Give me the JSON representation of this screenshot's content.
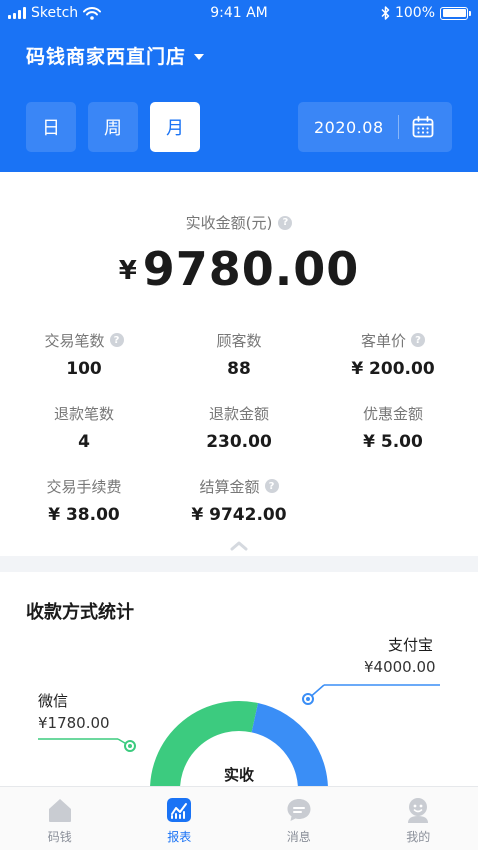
{
  "status_bar": {
    "carrier": "Sketch",
    "time": "9:41 AM",
    "battery": "100%"
  },
  "header": {
    "store_name": "码钱商家西直门店",
    "periods": [
      {
        "label": "日",
        "active": false
      },
      {
        "label": "周",
        "active": false
      },
      {
        "label": "月",
        "active": true
      }
    ],
    "date": "2020.08"
  },
  "summary": {
    "amount_label": "实收金额(元)",
    "currency": "¥",
    "amount": "9780.00",
    "stats": [
      {
        "label": "交易笔数",
        "value": "100",
        "help": true
      },
      {
        "label": "顾客数",
        "value": "88",
        "help": false
      },
      {
        "label": "客单价",
        "value": "¥ 200.00",
        "help": true
      },
      {
        "label": "退款笔数",
        "value": "4",
        "help": false
      },
      {
        "label": "退款金额",
        "value": "230.00",
        "help": false
      },
      {
        "label": "优惠金额",
        "value": "¥ 5.00",
        "help": false
      },
      {
        "label": "交易手续费",
        "value": "¥ 38.00",
        "help": false
      },
      {
        "label": "结算金额",
        "value": "¥ 9742.00",
        "help": true
      }
    ]
  },
  "payment_methods": {
    "title": "收款方式统计",
    "center_label": "实收",
    "items": [
      {
        "name": "微信",
        "value": "¥1780.00",
        "amount": 1780,
        "color": "#3ccb7f"
      },
      {
        "name": "支付宝",
        "value": "¥4000.00",
        "amount": 4000,
        "color": "#3a8ef6"
      }
    ]
  },
  "tabbar": [
    {
      "label": "码钱",
      "icon": "home-icon",
      "active": false
    },
    {
      "label": "报表",
      "icon": "report-icon",
      "active": true
    },
    {
      "label": "消息",
      "icon": "message-icon",
      "active": false
    },
    {
      "label": "我的",
      "icon": "profile-icon",
      "active": false
    }
  ],
  "colors": {
    "brand": "#1a73f5",
    "wechat": "#3ccb7f",
    "alipay": "#3a8ef6"
  }
}
